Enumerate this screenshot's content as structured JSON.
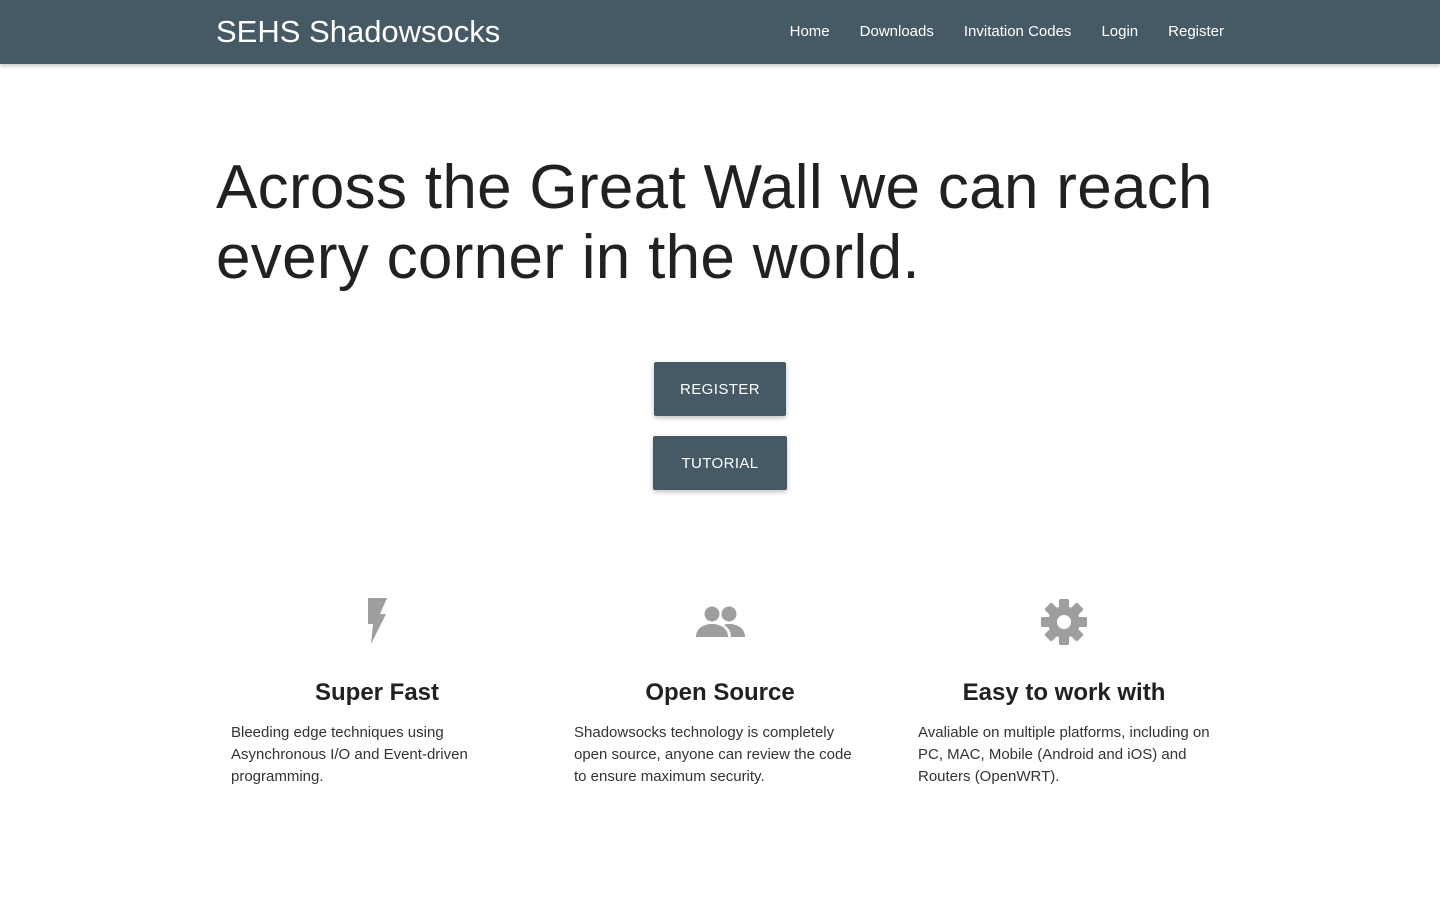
{
  "nav": {
    "brand": "SEHS Shadowsocks",
    "links": [
      {
        "label": "Home"
      },
      {
        "label": "Downloads"
      },
      {
        "label": "Invitation Codes"
      },
      {
        "label": "Login"
      },
      {
        "label": "Register"
      }
    ]
  },
  "hero": {
    "title": "Across the Great Wall we can reach every corner in the world.",
    "register_label": "REGISTER",
    "tutorial_label": "TUTORIAL"
  },
  "features": [
    {
      "icon": "lightning-bolt-icon",
      "title": "Super Fast",
      "text": "Bleeding edge techniques using Asynchronous I/O and Event-driven programming."
    },
    {
      "icon": "people-icon",
      "title": "Open Source",
      "text": "Shadowsocks technology is completely open source, anyone can review the code to ensure maximum security."
    },
    {
      "icon": "gear-icon",
      "title": "Easy to work with",
      "text": "Avaliable on multiple platforms, including on PC, MAC, Mobile (Android and iOS) and Routers (OpenWRT)."
    }
  ],
  "colors": {
    "primary": "#455a64",
    "icon": "#9e9e9e",
    "text": "#212121"
  }
}
